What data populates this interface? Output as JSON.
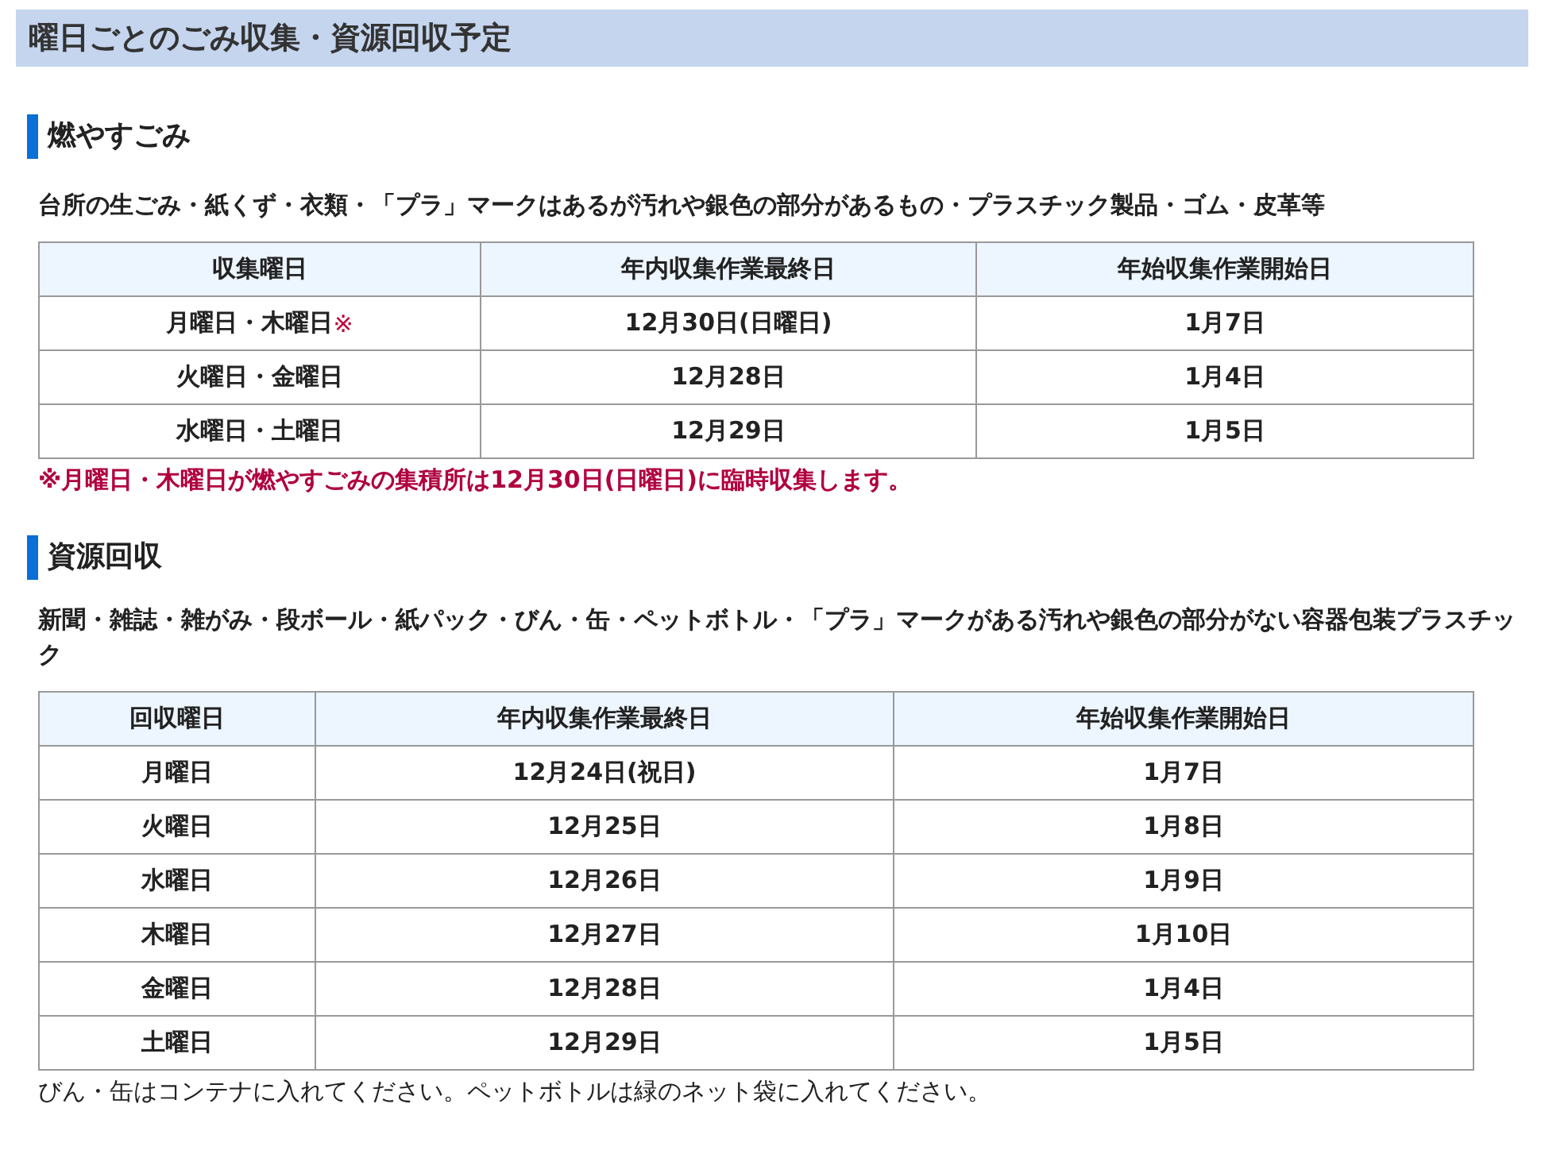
{
  "page_title": "曜日ごとのごみ収集・資源回収予定",
  "sections": [
    {
      "heading": "燃やすごみ",
      "description": "台所の生ごみ・紙くず・衣類・「プラ」マークはあるが汚れや銀色の部分があるもの・プラスチック製品・ゴム・皮革等",
      "table": {
        "columns": [
          "収集曜日",
          "年内収集作業最終日",
          "年始収集作業開始日"
        ],
        "rows": [
          [
            {
              "text": "月曜日・木曜日",
              "note_mark": "※"
            },
            {
              "text": "12月30日(日曜日)"
            },
            {
              "text": "1月7日"
            }
          ],
          [
            {
              "text": "火曜日・金曜日"
            },
            {
              "text": "12月28日"
            },
            {
              "text": "1月4日"
            }
          ],
          [
            {
              "text": "水曜日・土曜日"
            },
            {
              "text": "12月29日"
            },
            {
              "text": "1月5日"
            }
          ]
        ]
      },
      "note": {
        "text": "※月曜日・木曜日が燃やすごみの集積所は12月30日(日曜日)に臨時収集します。",
        "kind": "warning"
      }
    },
    {
      "heading": "資源回収",
      "description": "新聞・雑誌・雑がみ・段ボール・紙パック・びん・缶・ペットボトル・「プラ」マークがある汚れや銀色の部分がない容器包装プラスチック",
      "table": {
        "columns": [
          "回収曜日",
          "年内収集作業最終日",
          "年始収集作業開始日"
        ],
        "rows": [
          [
            {
              "text": "月曜日"
            },
            {
              "text": "12月24日(祝日)"
            },
            {
              "text": "1月7日"
            }
          ],
          [
            {
              "text": "火曜日"
            },
            {
              "text": "12月25日"
            },
            {
              "text": "1月8日"
            }
          ],
          [
            {
              "text": "水曜日"
            },
            {
              "text": "12月26日"
            },
            {
              "text": "1月9日"
            }
          ],
          [
            {
              "text": "木曜日"
            },
            {
              "text": "12月27日"
            },
            {
              "text": "1月10日"
            }
          ],
          [
            {
              "text": "金曜日"
            },
            {
              "text": "12月28日"
            },
            {
              "text": "1月4日"
            }
          ],
          [
            {
              "text": "土曜日"
            },
            {
              "text": "12月29日"
            },
            {
              "text": "1月5日"
            }
          ]
        ]
      },
      "note": {
        "text": "びん・缶はコンテナに入れてください。ペットボトルは緑のネット袋に入れてください。",
        "kind": "plain"
      }
    }
  ]
}
